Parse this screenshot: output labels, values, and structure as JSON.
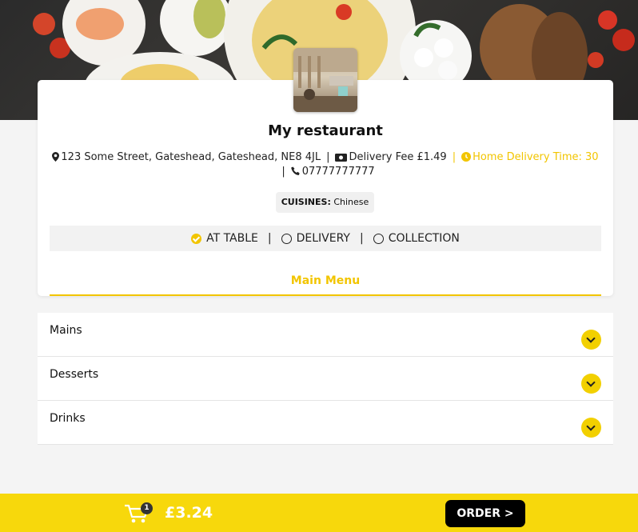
{
  "restaurant": {
    "name": "My restaurant",
    "address": "123 Some Street, Gateshead, Gateshead, NE8 4JL",
    "delivery_fee": "Delivery Fee £1.49",
    "home_delivery_time": "Home Delivery Time: 30",
    "phone": "07777777777",
    "cuisines_label": "CUISINES:",
    "cuisines_value": "Chinese"
  },
  "order_modes": [
    {
      "label": "AT TABLE",
      "selected": true
    },
    {
      "label": "DELIVERY",
      "selected": false
    },
    {
      "label": "COLLECTION",
      "selected": false
    }
  ],
  "menu_tab": "Main Menu",
  "categories": [
    "Mains",
    "Desserts",
    "Drinks"
  ],
  "footer": {
    "cart_count": "1",
    "total": "£3.24",
    "order_label": "ORDER >"
  },
  "colors": {
    "accent": "#f2c500",
    "footer": "#f7d80c"
  },
  "icons": [
    "map-marker-icon",
    "money-icon",
    "clock-icon",
    "phone-icon",
    "check-circle-icon",
    "chevron-down-icon",
    "cart-icon"
  ]
}
